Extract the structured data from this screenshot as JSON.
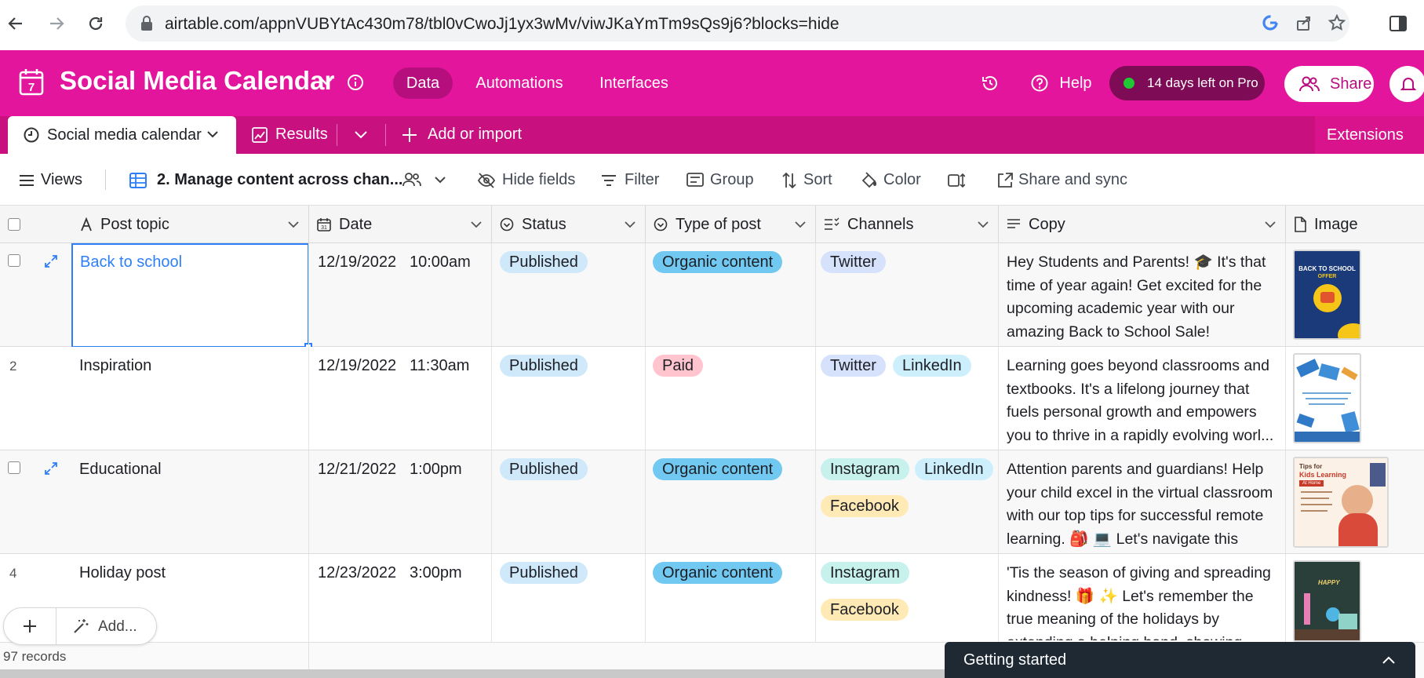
{
  "browser": {
    "url": "airtable.com/appnVUBYtAc430m78/tbl0vCwoJj1yx3wMv/viwJKaYmTm9sQs9j6?blocks=hide"
  },
  "header": {
    "base_title": "Social Media Calendar",
    "nav": [
      "Data",
      "Automations",
      "Interfaces"
    ],
    "help": "Help",
    "pro": "14 days left on Pro",
    "share": "Share"
  },
  "tabs": {
    "active": "Social media calendar",
    "second": "Results",
    "add": "Add or import",
    "extensions": "Extensions"
  },
  "toolbar": {
    "views": "Views",
    "view_name": "2. Manage content across chan...",
    "hide_fields": "Hide fields",
    "filter": "Filter",
    "group": "Group",
    "sort": "Sort",
    "color": "Color",
    "share_sync": "Share and sync"
  },
  "columns": [
    "Post topic",
    "Date",
    "Status",
    "Type of post",
    "Channels",
    "Copy",
    "Image"
  ],
  "rows": [
    {
      "num": "",
      "topic": "Back to school",
      "date": "12/19/2022",
      "time": "10:00am",
      "status": "Published",
      "type": "Organic content",
      "channels": [
        "Twitter"
      ],
      "copy": "Hey Students and Parents! 🎓 It's that time of year again! Get excited for the upcoming academic year with our amazing Back to School Sale!"
    },
    {
      "num": "2",
      "topic": "Inspiration",
      "date": "12/19/2022",
      "time": "11:30am",
      "status": "Published",
      "type": "Paid",
      "channels": [
        "Twitter",
        "LinkedIn"
      ],
      "copy": "Learning goes beyond classrooms and textbooks. It's a lifelong journey that fuels personal growth and empowers you to thrive in a rapidly evolving worl..."
    },
    {
      "num": "",
      "topic": "Educational",
      "date": "12/21/2022",
      "time": "1:00pm",
      "status": "Published",
      "type": "Organic content",
      "channels": [
        "Instagram",
        "LinkedIn",
        "Facebook"
      ],
      "copy": "Attention parents and guardians! Help your child excel in the virtual classroom with our top tips for successful remote learning. 🎒 💻 Let's navigate this new..."
    },
    {
      "num": "4",
      "topic": "Holiday post",
      "date": "12/23/2022",
      "time": "3:00pm",
      "status": "Published",
      "type": "Organic content",
      "channels": [
        "Instagram",
        "Facebook"
      ],
      "copy": "'Tis the season of giving and spreading kindness! 🎁 ✨ Let's remember the true meaning of the holidays by extending a helping hand, showing"
    }
  ],
  "thumbs": {
    "t1_title": "BACK TO SCHOOL",
    "t1_sub": "OFFER",
    "t3_title": "Tips for",
    "t3_sub": "Kids Learning",
    "t3_tag": "At Home",
    "t4_title": "HAPPY"
  },
  "footer": {
    "add": "Add...",
    "records": "97 records",
    "getting_started": "Getting started"
  },
  "colors": {
    "header": "#e3159c",
    "tabs": "#c8107f",
    "published": "#cfe9fb",
    "organic": "#71c8f0",
    "paid": "#ffc4cd",
    "twitter": "#d6e2fb",
    "linkedin": "#cdeffc",
    "instagram": "#c7f1ec",
    "facebook": "#ffeab6"
  }
}
